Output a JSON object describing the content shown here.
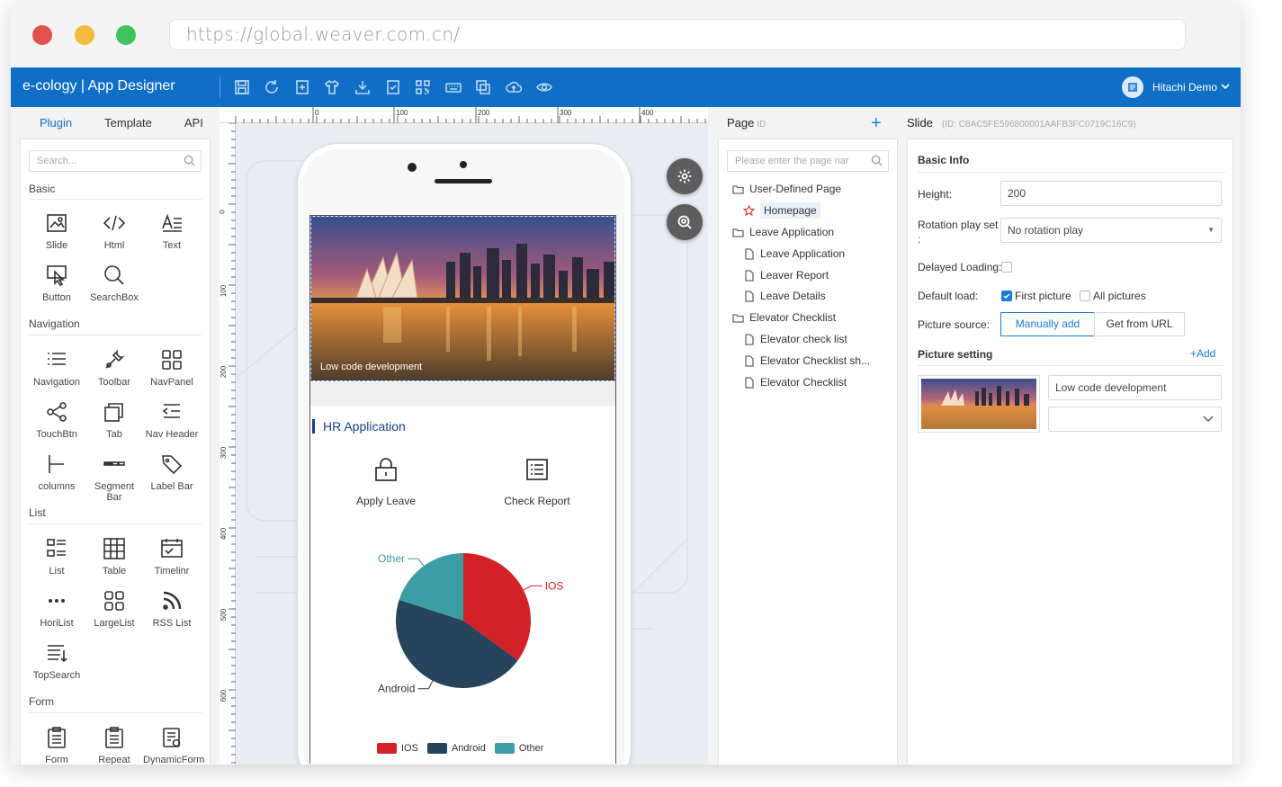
{
  "browser": {
    "url": "https://global.weaver.com.cn/",
    "dots": [
      "#e0524e",
      "#f1bb3e",
      "#3fc160"
    ]
  },
  "app": {
    "title": "e-cology | App Designer",
    "user": "Hitachi Demo",
    "accent": "#0f6fc6"
  },
  "left": {
    "tabs": [
      "Plugin",
      "Template",
      "API"
    ],
    "search_placeholder": "Search...",
    "sections": {
      "basic": "Basic",
      "navigation": "Navigation",
      "list": "List",
      "form": "Form"
    },
    "basic": [
      "Slide",
      "Html",
      "Text",
      "Button",
      "SearchBox"
    ],
    "navigation": [
      "Navigation",
      "Toolbar",
      "NavPanel",
      "TouchBtn",
      "Tab",
      "Nav Header",
      "columns",
      "Segment Bar",
      "Label Bar"
    ],
    "list": [
      "List",
      "Table",
      "Timelinr",
      "HoriList",
      "LargeList",
      "RSS List",
      "TopSearch"
    ],
    "form": [
      "Form",
      "Repeat Table",
      "DynamicForm"
    ]
  },
  "ruler": {
    "top": [
      "0",
      "100",
      "200",
      "300",
      "400"
    ],
    "left": [
      "0",
      "100",
      "200",
      "300",
      "400",
      "500",
      "600"
    ]
  },
  "phone": {
    "banner_caption": "Low code development",
    "section_title": "HR Application",
    "apps": [
      "Apply Leave",
      "Check Report"
    ],
    "pie_labels": [
      "Other",
      "IOS",
      "Android"
    ],
    "legend": [
      "IOS",
      "Android",
      "Other"
    ]
  },
  "chart_data": {
    "type": "pie",
    "categories": [
      "IOS",
      "Android",
      "Other"
    ],
    "values": [
      35,
      45,
      20
    ],
    "colors": [
      "#d42128",
      "#27445a",
      "#3c9da4"
    ]
  },
  "page": {
    "title": "Page",
    "id_label": "ID",
    "search_placeholder": "Please enter the page nar",
    "tree": [
      {
        "label": "User-Defined Page",
        "level": 0,
        "icon": "folder-icon"
      },
      {
        "label": "Homepage",
        "level": 1,
        "icon": "star-icon",
        "selected": true
      },
      {
        "label": "Leave Application",
        "level": 0,
        "icon": "folder-icon"
      },
      {
        "label": "Leave Application",
        "level": 1,
        "icon": "file-icon"
      },
      {
        "label": "Leaver Report",
        "level": 1,
        "icon": "file-icon"
      },
      {
        "label": "Leave Details",
        "level": 1,
        "icon": "file-icon"
      },
      {
        "label": "Elevator Checklist",
        "level": 0,
        "icon": "folder-icon"
      },
      {
        "label": "Elevator check list",
        "level": 1,
        "icon": "file-icon"
      },
      {
        "label": "Elevator Checklist sh...",
        "level": 1,
        "icon": "file-icon"
      },
      {
        "label": "Elevator Checklist",
        "level": 1,
        "icon": "file-icon"
      }
    ]
  },
  "slide": {
    "title": "Slide",
    "id_text": "(ID: C8AC5FE596800001AAFB3FC0719C16C9)",
    "basic_info": "Basic Info",
    "height_label": "Height:",
    "height_value": "200",
    "rotation_label": "Rotation play set",
    "rotation_colon": ":",
    "rotation_value": "No rotation play",
    "delayed_label": "Delayed Loading:",
    "default_load_label": "Default load:",
    "first_picture": "First picture",
    "all_pictures": "All pictures",
    "picture_source_label": "Picture source:",
    "manually_add": "Manually add",
    "get_from_url": "Get from URL",
    "picture_setting": "Picture setting",
    "add": "+Add",
    "caption_value": "Low code development"
  }
}
